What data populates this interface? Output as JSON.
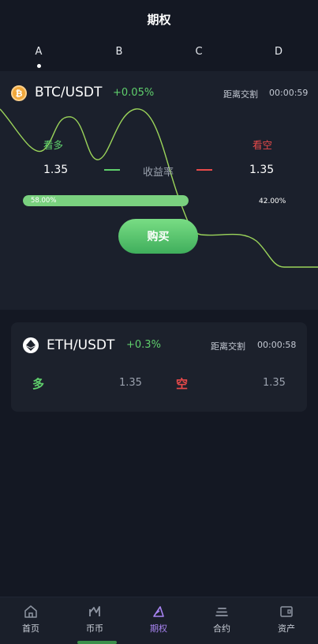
{
  "header": {
    "title": "期权"
  },
  "tabs": [
    {
      "label": "A",
      "active": true
    },
    {
      "label": "B",
      "active": false
    },
    {
      "label": "C",
      "active": false
    },
    {
      "label": "D",
      "active": false
    }
  ],
  "btc_card": {
    "pair": "BTC/USDT",
    "change": "+0.05%",
    "settle_label": "距离交割",
    "settle_time": "00:00:59",
    "long_label": "看多",
    "short_label": "看空",
    "long_price": "1.35",
    "short_price": "1.35",
    "yield_label": "收益率",
    "long_ratio_text": "58.00%",
    "short_ratio_text": "42.00%",
    "long_ratio": 0.58,
    "buy_label": "购买",
    "icon": "bitcoin-icon"
  },
  "eth_card": {
    "pair": "ETH/USDT",
    "change": "+0.3%",
    "settle_label": "距离交割",
    "settle_time": "00:00:58",
    "long_label": "多",
    "short_label": "空",
    "long_price": "1.35",
    "short_price": "1.35",
    "icon": "ethereum-icon"
  },
  "bottom_nav": [
    {
      "label": "首页",
      "icon": "home-icon",
      "active": false
    },
    {
      "label": "币币",
      "icon": "trend-icon",
      "active": false
    },
    {
      "label": "期权",
      "icon": "options-icon",
      "active": true
    },
    {
      "label": "合约",
      "icon": "contract-icon",
      "active": false
    },
    {
      "label": "资产",
      "icon": "wallet-icon",
      "active": false
    }
  ],
  "colors": {
    "background": "#141823",
    "card": "#1b202c",
    "up": "#5fcf6c",
    "down": "#e84a4a",
    "active_nav": "#a884f2",
    "chart_line": "#9bd45a"
  }
}
